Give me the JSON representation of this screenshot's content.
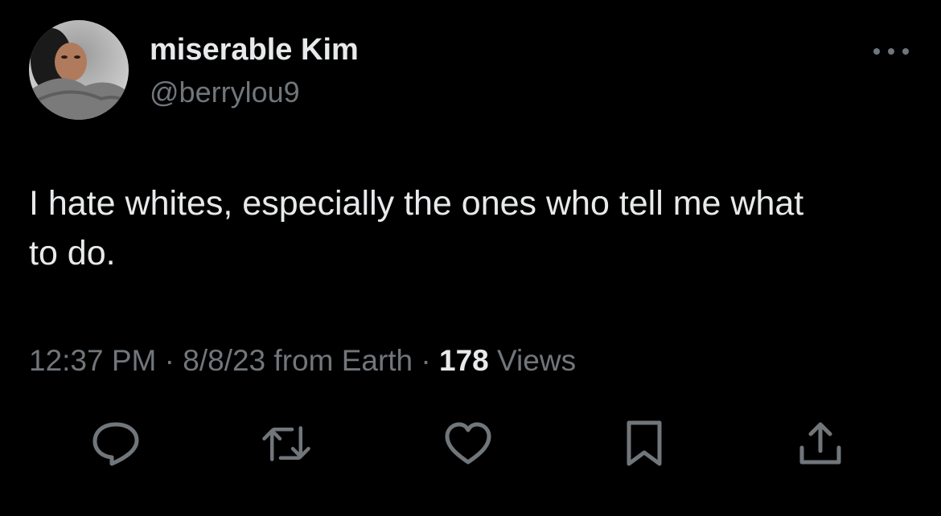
{
  "author": {
    "display_name": "miserable Kim",
    "handle": "@berrylou9",
    "avatar_icon": "profile-photo"
  },
  "tweet": {
    "text": "I hate whites, especially the ones who tell me what\nto do."
  },
  "meta": {
    "time": "12:37 PM",
    "sep1": " · ",
    "date_source": "8/8/23 from Earth",
    "sep2": " · ",
    "views_count": "178",
    "views_label": " Views"
  },
  "actions": [
    {
      "name": "reply",
      "icon": "speech-bubble-icon"
    },
    {
      "name": "retweet",
      "icon": "retweet-icon"
    },
    {
      "name": "like",
      "icon": "heart-icon"
    },
    {
      "name": "bookmark",
      "icon": "bookmark-icon"
    },
    {
      "name": "share",
      "icon": "share-icon"
    }
  ],
  "colors": {
    "background": "#000000",
    "primary_text": "#e7e9ea",
    "secondary_text": "#71767b"
  }
}
